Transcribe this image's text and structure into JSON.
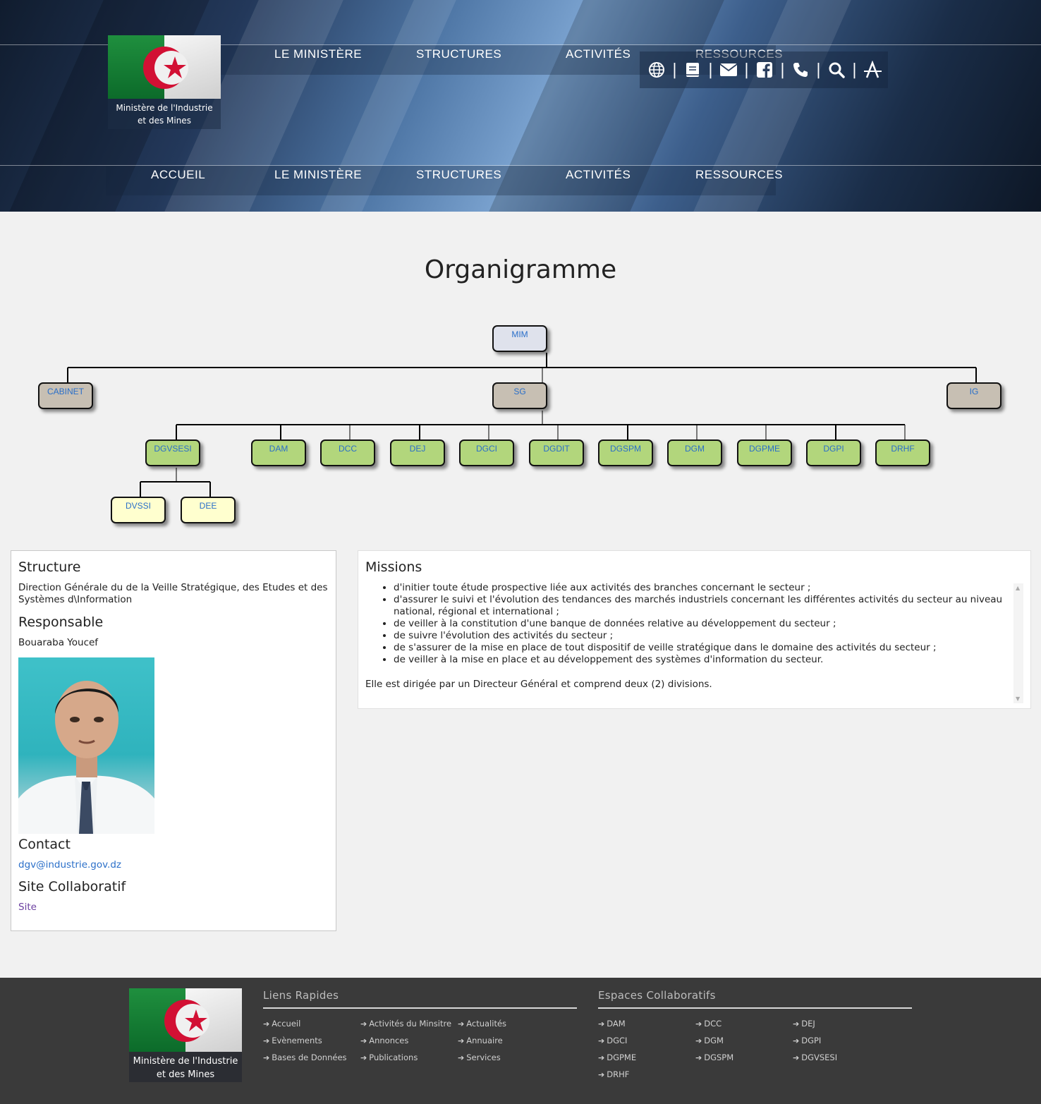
{
  "nav": {
    "items": [
      "ACCUEIL",
      "LE MINISTÈRE",
      "STRUCTURES",
      "ACTIVITÉS",
      "RESSOURCES"
    ]
  },
  "logo": {
    "caption_line1": "Ministère de l'Industrie",
    "caption_line2": "et des Mines"
  },
  "toolbar_icons": [
    "globe-icon",
    "book-icon",
    "envelope-icon",
    "facebook-icon",
    "phone-icon",
    "search-icon",
    "font-size-icon"
  ],
  "page": {
    "title": "Organigramme"
  },
  "org": {
    "root": "MIM",
    "level1": [
      "CABINET",
      "SG",
      "IG"
    ],
    "directions": [
      "DGVSESI",
      "DAM",
      "DCC",
      "DEJ",
      "DGCI",
      "DGDIT",
      "DGSPM",
      "DGM",
      "DGPME",
      "DGPI",
      "DRHF"
    ],
    "divisions": [
      "DVSSI",
      "DEE"
    ]
  },
  "structure": {
    "heading": "Structure",
    "name": "Direction Générale du de la Veille Stratégique, des Etudes et des Systèmes d\\Information",
    "responsable_heading": "Responsable",
    "responsable": "Bouaraba Youcef",
    "contact_heading": "Contact",
    "email": "dgv@industrie.gov.dz",
    "site_heading": "Site Collaboratif",
    "site_link": "Site"
  },
  "missions": {
    "heading": "Missions",
    "items": [
      "d'initier toute étude prospective liée aux activités des branches concernant le secteur ;",
      "d'assurer le suivi et l'évolution des tendances des marchés industriels concernant les différentes activités du secteur au niveau national, régional et international ;",
      "de veiller à la constitution d'une banque de données relative au développement du secteur ;",
      "de suivre l'évolution des activités du secteur ;",
      "de s'assurer de la mise en place de tout dispositif de veille stratégique dans le domaine des activités du secteur ;",
      "de veiller à la mise en place et au développement des systèmes d'information du secteur."
    ],
    "closing": "Elle est dirigée par un Directeur Général et comprend deux (2) divisions."
  },
  "footer": {
    "quick_links_heading": "Liens Rapides",
    "quick_links": [
      "Accueil",
      "Activités du Minsitre",
      "Actualités",
      "Evènements",
      "Annonces",
      "Annuaire",
      "Bases de Données",
      "Publications",
      "Services"
    ],
    "collab_heading": "Espaces Collaboratifs",
    "collab_links": [
      "DAM",
      "DCC",
      "DEJ",
      "DGCI",
      "DGM",
      "DGPI",
      "DGPME",
      "DGSPM",
      "DGVSESI",
      "DRHF"
    ]
  },
  "colors": {
    "node_root": "#dfe2ec",
    "node_level1": "#c7bfb3",
    "node_direction": "#b2d67c",
    "node_division": "#ffffcf",
    "link": "#2a6fc9",
    "footer_bg": "#3a3a3a"
  }
}
